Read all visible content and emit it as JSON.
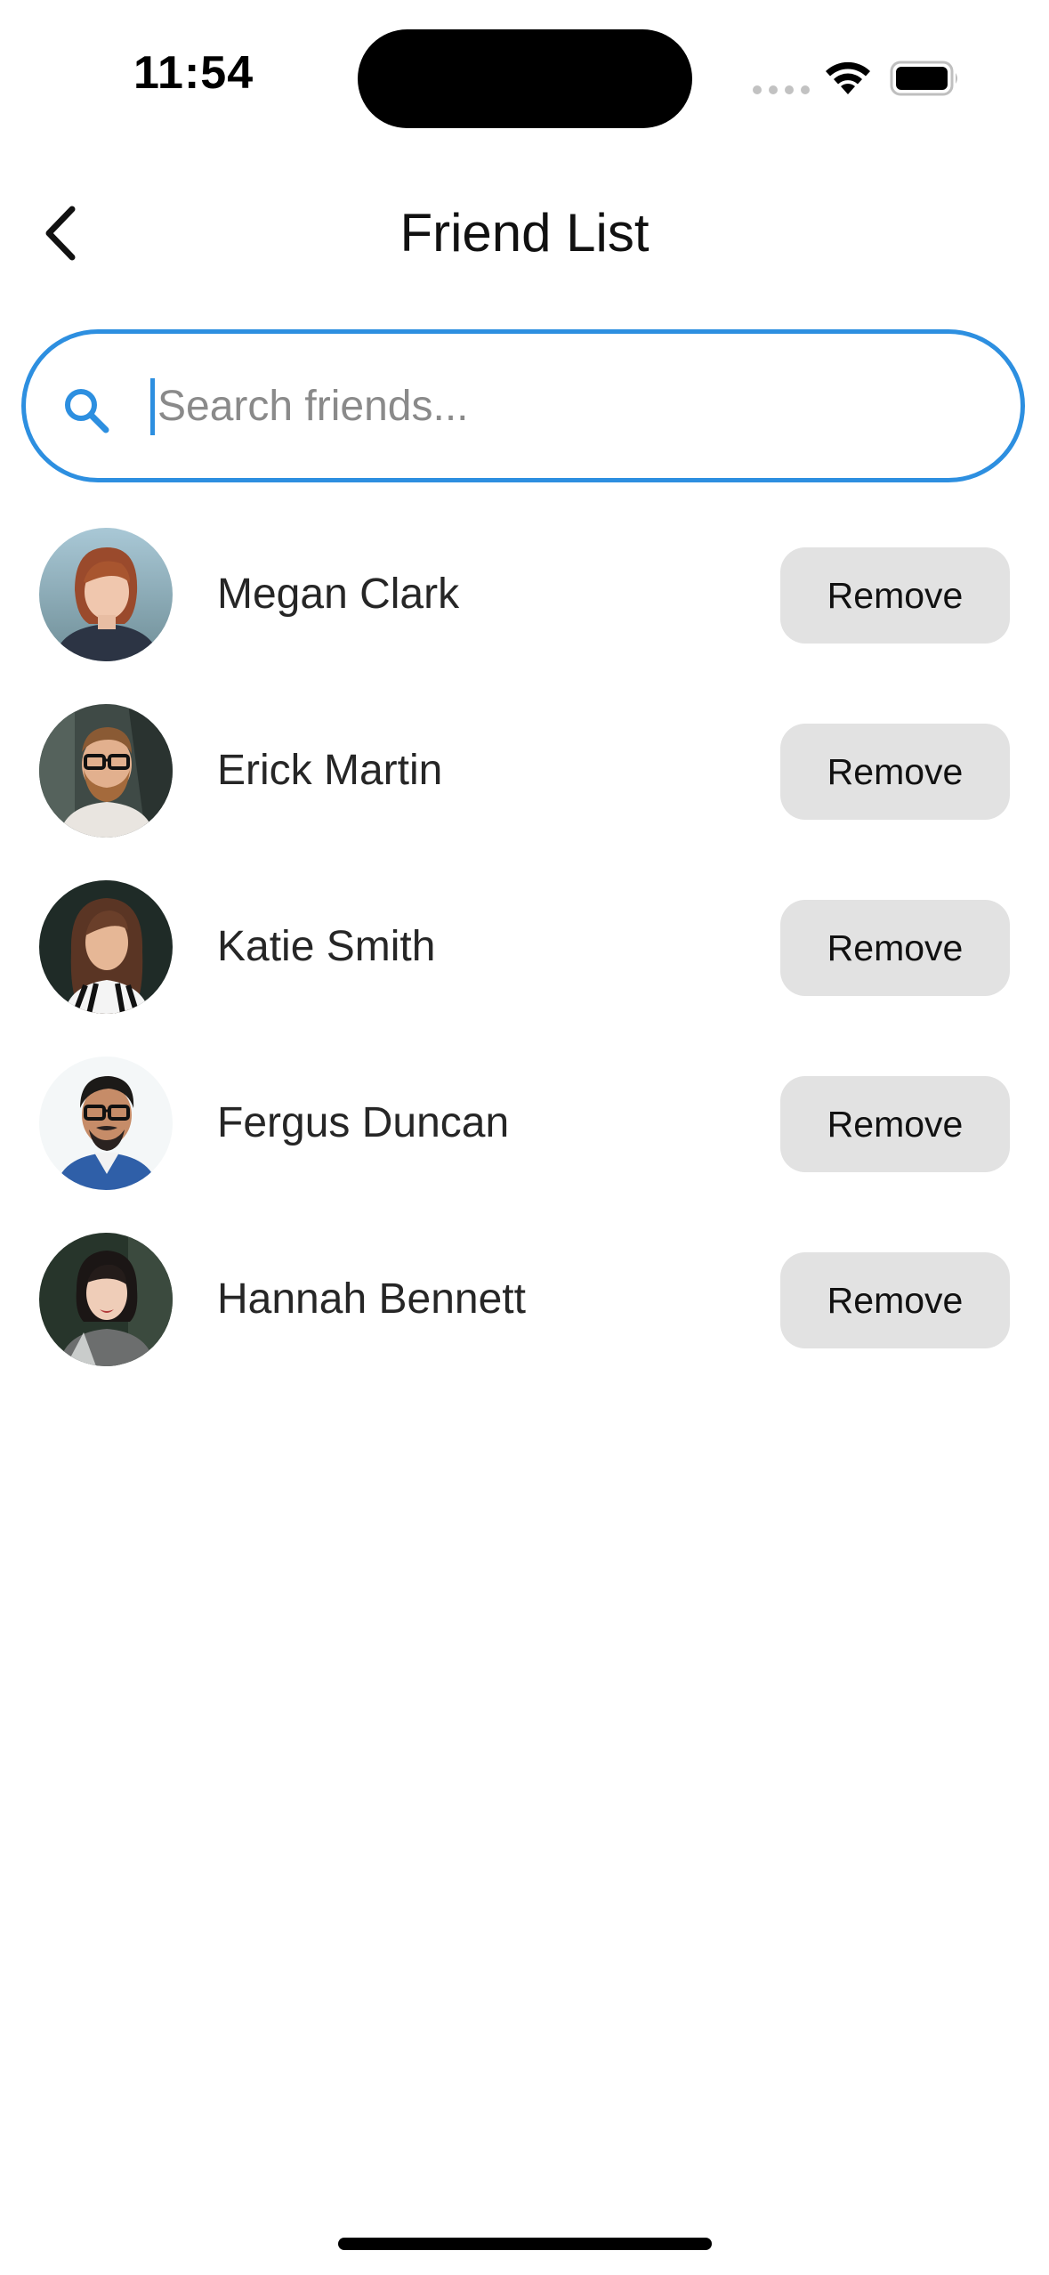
{
  "status_bar": {
    "time": "11:54"
  },
  "header": {
    "title": "Friend List",
    "back_icon": "chevron-left-icon"
  },
  "search": {
    "value": "",
    "placeholder": "Search friends...",
    "icon": "search-icon",
    "accent_color": "#2d8fe0"
  },
  "friends": [
    {
      "name": "Megan Clark",
      "action_label": "Remove"
    },
    {
      "name": "Erick Martin",
      "action_label": "Remove"
    },
    {
      "name": "Katie Smith",
      "action_label": "Remove"
    },
    {
      "name": "Fergus Duncan",
      "action_label": "Remove"
    },
    {
      "name": "Hannah Bennett",
      "action_label": "Remove"
    }
  ]
}
